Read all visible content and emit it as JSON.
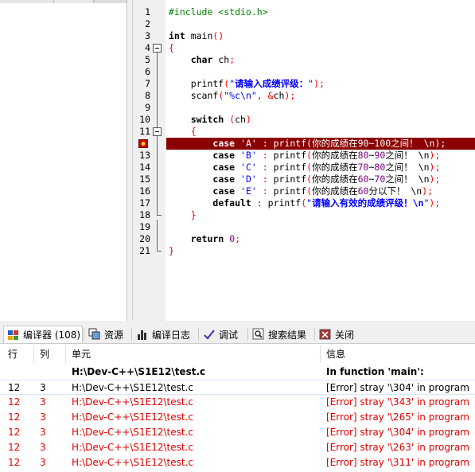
{
  "code": {
    "lines": [
      {
        "n": "1",
        "parts": [
          [
            "pre",
            "#include <stdio.h>"
          ]
        ]
      },
      {
        "n": "2",
        "parts": []
      },
      {
        "n": "3",
        "parts": [
          [
            "kw",
            "int"
          ],
          [
            "ident",
            " main"
          ],
          [
            "sym",
            "()"
          ]
        ]
      },
      {
        "n": "4",
        "parts": [
          [
            "sym",
            "{"
          ]
        ]
      },
      {
        "n": "5",
        "parts": [
          [
            "ident",
            "    "
          ],
          [
            "kw",
            "char"
          ],
          [
            "ident",
            " ch"
          ],
          [
            "sym",
            ";"
          ]
        ]
      },
      {
        "n": "6",
        "parts": []
      },
      {
        "n": "7",
        "parts": [
          [
            "ident",
            "    printf"
          ],
          [
            "sym",
            "("
          ],
          [
            "str",
            "\""
          ],
          [
            "strcn",
            "请输入成绩评级："
          ],
          [
            "str",
            "\""
          ],
          [
            "sym",
            ");"
          ]
        ]
      },
      {
        "n": "8",
        "parts": [
          [
            "ident",
            "    scanf"
          ],
          [
            "sym",
            "("
          ],
          [
            "str",
            "\"%c\\n\""
          ],
          [
            "sym",
            ", &"
          ],
          [
            "ident",
            "ch"
          ],
          [
            "sym",
            ");"
          ]
        ]
      },
      {
        "n": "9",
        "parts": []
      },
      {
        "n": "10",
        "parts": [
          [
            "ident",
            "    "
          ],
          [
            "kw",
            "switch"
          ],
          [
            "ident",
            " "
          ],
          [
            "sym",
            "("
          ],
          [
            "ident",
            "ch"
          ],
          [
            "sym",
            ")"
          ]
        ]
      },
      {
        "n": "11",
        "parts": [
          [
            "ident",
            "    "
          ],
          [
            "sym",
            "{"
          ]
        ]
      },
      {
        "n": "12",
        "parts": [
          [
            "ident",
            "        "
          ],
          [
            "kw",
            "case"
          ],
          [
            "ident",
            " "
          ],
          [
            "str",
            "'A'"
          ],
          [
            "ident",
            " "
          ],
          [
            "sym",
            ":"
          ],
          [
            "ident",
            " printf"
          ],
          [
            "sym",
            "("
          ],
          [
            "ident",
            "你的成绩在"
          ],
          [
            "num",
            "90"
          ],
          [
            "ident",
            "~"
          ],
          [
            "num",
            "100"
          ],
          [
            "ident",
            "之间！ \\n"
          ],
          [
            "sym",
            ");"
          ]
        ]
      },
      {
        "n": "13",
        "parts": [
          [
            "ident",
            "        "
          ],
          [
            "kw",
            "case"
          ],
          [
            "ident",
            " "
          ],
          [
            "str",
            "'B'"
          ],
          [
            "ident",
            " "
          ],
          [
            "sym",
            ":"
          ],
          [
            "ident",
            " printf"
          ],
          [
            "sym",
            "("
          ],
          [
            "ident",
            "你的成绩在"
          ],
          [
            "num",
            "80"
          ],
          [
            "ident",
            "~"
          ],
          [
            "num",
            "90"
          ],
          [
            "ident",
            "之间！ \\n"
          ],
          [
            "sym",
            ");"
          ]
        ]
      },
      {
        "n": "14",
        "parts": [
          [
            "ident",
            "        "
          ],
          [
            "kw",
            "case"
          ],
          [
            "ident",
            " "
          ],
          [
            "str",
            "'C'"
          ],
          [
            "ident",
            " "
          ],
          [
            "sym",
            ":"
          ],
          [
            "ident",
            " printf"
          ],
          [
            "sym",
            "("
          ],
          [
            "ident",
            "你的成绩在"
          ],
          [
            "num",
            "70"
          ],
          [
            "ident",
            "~"
          ],
          [
            "num",
            "80"
          ],
          [
            "ident",
            "之间！ \\n"
          ],
          [
            "sym",
            ");"
          ]
        ]
      },
      {
        "n": "15",
        "parts": [
          [
            "ident",
            "        "
          ],
          [
            "kw",
            "case"
          ],
          [
            "ident",
            " "
          ],
          [
            "str",
            "'D'"
          ],
          [
            "ident",
            " "
          ],
          [
            "sym",
            ":"
          ],
          [
            "ident",
            " printf"
          ],
          [
            "sym",
            "("
          ],
          [
            "ident",
            "你的成绩在"
          ],
          [
            "num",
            "60"
          ],
          [
            "ident",
            "~"
          ],
          [
            "num",
            "70"
          ],
          [
            "ident",
            "之间！ \\n"
          ],
          [
            "sym",
            ");"
          ]
        ]
      },
      {
        "n": "16",
        "parts": [
          [
            "ident",
            "        "
          ],
          [
            "kw",
            "case"
          ],
          [
            "ident",
            " "
          ],
          [
            "str",
            "'E'"
          ],
          [
            "ident",
            " "
          ],
          [
            "sym",
            ":"
          ],
          [
            "ident",
            " printf"
          ],
          [
            "sym",
            "("
          ],
          [
            "ident",
            "你的成绩在"
          ],
          [
            "num",
            "60"
          ],
          [
            "ident",
            "分以下！ \\n"
          ],
          [
            "sym",
            ");"
          ]
        ]
      },
      {
        "n": "17",
        "parts": [
          [
            "ident",
            "        "
          ],
          [
            "kw",
            "default"
          ],
          [
            "ident",
            " "
          ],
          [
            "sym",
            ":"
          ],
          [
            "ident",
            " printf"
          ],
          [
            "sym",
            "("
          ],
          [
            "str",
            "\""
          ],
          [
            "strcn",
            "请输入有效的成绩评级！\\n"
          ],
          [
            "str",
            "\""
          ],
          [
            "sym",
            ");"
          ]
        ]
      },
      {
        "n": "18",
        "parts": [
          [
            "ident",
            "    "
          ],
          [
            "sym",
            "}"
          ]
        ]
      },
      {
        "n": "19",
        "parts": []
      },
      {
        "n": "20",
        "parts": [
          [
            "ident",
            "    "
          ],
          [
            "kw",
            "return"
          ],
          [
            "ident",
            " "
          ],
          [
            "num",
            "0"
          ],
          [
            "sym",
            ";"
          ]
        ]
      },
      {
        "n": "21",
        "parts": [
          [
            "sym",
            "}"
          ]
        ]
      }
    ],
    "error_line": "12"
  },
  "tabs": [
    {
      "label": "编译器 (108)",
      "icon": "compiler-icon"
    },
    {
      "label": "资源",
      "icon": "resources-icon"
    },
    {
      "label": "编译日志",
      "icon": "compile-log-icon"
    },
    {
      "label": "调试",
      "icon": "debug-icon"
    },
    {
      "label": "搜索结果",
      "icon": "search-results-icon"
    },
    {
      "label": "关闭",
      "icon": "close-icon"
    }
  ],
  "results": {
    "headers": {
      "line": "行",
      "col": "列",
      "unit": "单元",
      "message": "信息"
    },
    "context": {
      "unit": "H:\\Dev-C++\\S1E12\\test.c",
      "message": "In function 'main':"
    },
    "rows": [
      {
        "line": "12",
        "col": "3",
        "unit": "H:\\Dev-C++\\S1E12\\test.c",
        "message": "[Error] stray '\\304' in program"
      },
      {
        "line": "12",
        "col": "3",
        "unit": "H:\\Dev-C++\\S1E12\\test.c",
        "message": "[Error] stray '\\343' in program"
      },
      {
        "line": "12",
        "col": "3",
        "unit": "H:\\Dev-C++\\S1E12\\test.c",
        "message": "[Error] stray '\\265' in program"
      },
      {
        "line": "12",
        "col": "3",
        "unit": "H:\\Dev-C++\\S1E12\\test.c",
        "message": "[Error] stray '\\304' in program"
      },
      {
        "line": "12",
        "col": "3",
        "unit": "H:\\Dev-C++\\S1E12\\test.c",
        "message": "[Error] stray '\\263' in program"
      },
      {
        "line": "12",
        "col": "3",
        "unit": "H:\\Dev-C++\\S1E12\\test.c",
        "message": "[Error] stray '\\311' in program"
      }
    ]
  },
  "colors": {
    "error_line_bg": "#8b0000",
    "error_text": "#e00000",
    "string": "#0000ff",
    "symbol": "#ff0000",
    "number": "#800080",
    "preprocessor": "#008000"
  }
}
